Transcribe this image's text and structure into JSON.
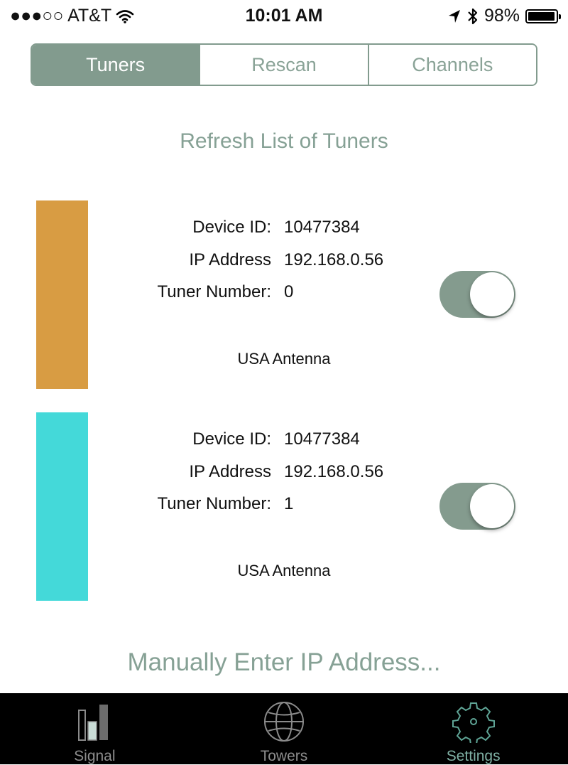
{
  "status_bar": {
    "carrier": "●●●○○ AT&T",
    "time": "10:01 AM",
    "battery": "98%",
    "battery_level": 0.98
  },
  "segments": [
    {
      "label": "Tuners",
      "selected": true
    },
    {
      "label": "Rescan",
      "selected": false
    },
    {
      "label": "Channels",
      "selected": false
    }
  ],
  "refresh_label": "Refresh List of Tuners",
  "tuners": [
    {
      "color": "#d89c43",
      "device_id_label": "Device ID:",
      "device_id": "10477384",
      "ip_label": "IP Address",
      "ip": "192.168.0.56",
      "tuner_label": "Tuner Number:",
      "tuner_number": "0",
      "antenna": "USA Antenna",
      "enabled": true
    },
    {
      "color": "#44d9d9",
      "device_id_label": "Device ID:",
      "device_id": "10477384",
      "ip_label": "IP Address",
      "ip": "192.168.0.56",
      "tuner_label": "Tuner Number:",
      "tuner_number": "1",
      "antenna": "USA Antenna",
      "enabled": true
    }
  ],
  "manual_entry_label": "Manually Enter IP Address...",
  "tab_bar": [
    {
      "label": "Signal",
      "icon": "signal-bars-icon",
      "active": false
    },
    {
      "label": "Towers",
      "icon": "globe-icon",
      "active": false
    },
    {
      "label": "Settings",
      "icon": "gear-icon",
      "active": true
    }
  ],
  "colors": {
    "accent": "#829b8e",
    "accent_text": "#86a195",
    "active_tab": "#7fb0a4"
  }
}
